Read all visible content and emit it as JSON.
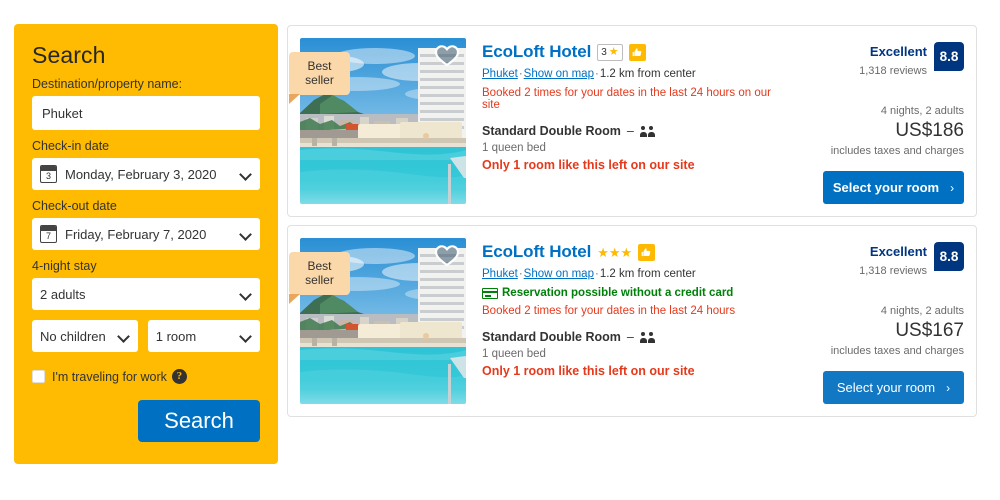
{
  "search": {
    "title": "Search",
    "destination_label": "Destination/property name:",
    "destination_value": "Phuket",
    "checkin_label": "Check-in date",
    "checkin_value": "Monday, February 3, 2020",
    "checkin_day": "3",
    "checkout_label": "Check-out date",
    "checkout_value": "Friday, February 7, 2020",
    "checkout_day": "7",
    "stay_label": "4-night stay",
    "adults_value": "2 adults",
    "children_value": "No children",
    "rooms_value": "1 room",
    "work_label": "I'm traveling for work",
    "help_glyph": "?",
    "search_button": "Search",
    "accent_yellow": "#febb02",
    "accent_blue": "#0071c2"
  },
  "results": [
    {
      "ribbon": "Best seller",
      "name": "EcoLoft Hotel",
      "rating_style": "boxed",
      "star_count": 3,
      "star_label": "3",
      "star_glyph": "★",
      "city": "Phuket",
      "map_link": "Show on map",
      "distance": "1.2 km from center",
      "credit_card_note": "",
      "booked_note": "Booked 2 times for your dates in the last 24 hours on our site",
      "room_name": "Standard Double Room",
      "room_dash": "–",
      "bed_info": "1 queen bed",
      "availability": "Only 1 room like this left on our site",
      "score_word": "Excellent",
      "reviews": "1,318 reviews",
      "score": "8.8",
      "nights": "4 nights, 2 adults",
      "price": "US$186",
      "taxes": "includes taxes and charges",
      "cta": "Select your room",
      "cta_arrow": "›"
    },
    {
      "ribbon": "Best seller",
      "name": "EcoLoft Hotel",
      "rating_style": "plain",
      "star_count": 3,
      "star_label": "",
      "star_glyph": "★",
      "city": "Phuket",
      "map_link": "Show on map",
      "distance": "1.2 km from center",
      "credit_card_note": "Reservation possible without a credit card",
      "booked_note": "Booked 2 times for your dates in the last 24 hours",
      "room_name": "Standard Double Room",
      "room_dash": "–",
      "bed_info": "1 queen bed",
      "availability": "Only 1 room like this left on our site",
      "score_word": "Excellent",
      "reviews": "1,318 reviews",
      "score": "8.8",
      "nights": "4 nights, 2 adults",
      "price": "US$167",
      "taxes": "includes taxes and charges",
      "cta": "Select your room",
      "cta_arrow": "›"
    }
  ]
}
